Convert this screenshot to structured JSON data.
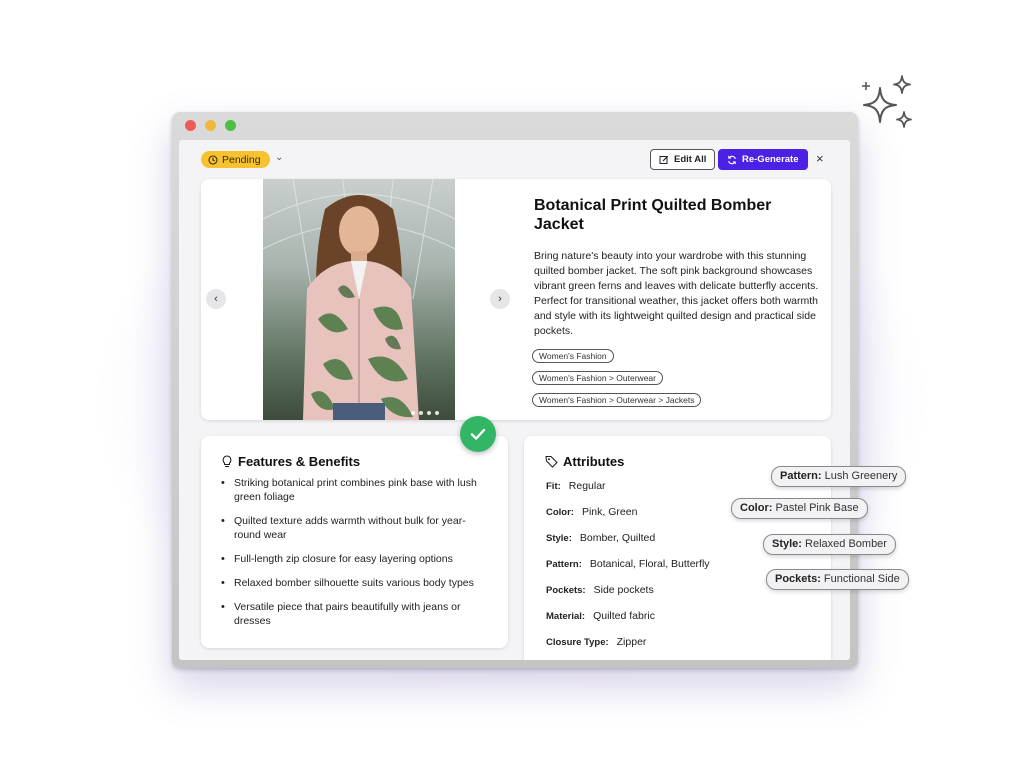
{
  "header": {
    "status": "Pending",
    "edit_all": "Edit All",
    "regenerate": "Re-Generate",
    "close": "×"
  },
  "product": {
    "title": "Botanical Print Quilted Bomber Jacket",
    "description": "Bring nature's beauty into your wardrobe with this stunning quilted bomber jacket. The soft pink background showcases vibrant green ferns and leaves with delicate butterfly accents. Perfect for transitional weather, this jacket offers both warmth and style with its lightweight quilted design and practical side pockets.",
    "categories": [
      "Women's Fashion",
      "Women's Fashion > Outerwear",
      "Women's Fashion > Outerwear > Jackets"
    ]
  },
  "features": {
    "title": "Features & Benefits",
    "items": [
      "Striking botanical print combines pink base with lush green foliage",
      "Quilted texture adds warmth without bulk for year-round wear",
      "Full-length zip closure for easy layering options",
      "Relaxed bomber silhouette suits various body types",
      "Versatile piece that pairs beautifully with jeans or dresses"
    ]
  },
  "attributes": {
    "title": "Attributes",
    "rows": [
      {
        "key": "Fit:",
        "value": "Regular"
      },
      {
        "key": "Color:",
        "value": "Pink, Green"
      },
      {
        "key": "Style:",
        "value": "Bomber, Quilted"
      },
      {
        "key": "Pattern:",
        "value": "Botanical, Floral, Butterfly"
      },
      {
        "key": "Pockets:",
        "value": "Side pockets"
      },
      {
        "key": "Material:",
        "value": "Quilted fabric"
      },
      {
        "key": "Closure Type:",
        "value": "Zipper"
      }
    ]
  },
  "chips": [
    {
      "key": "Pattern:",
      "value": "Lush Greenery"
    },
    {
      "key": "Color:",
      "value": "Pastel Pink Base"
    },
    {
      "key": "Style:",
      "value": "Relaxed Bomber"
    },
    {
      "key": "Pockets:",
      "value": "Functional Side"
    }
  ],
  "icons": {
    "status": "clock-icon",
    "caret": "chevron-down-icon",
    "edit": "edit-icon",
    "regenerate": "refresh-icon",
    "close": "close-icon",
    "features": "lightbulb-icon",
    "attributes": "tag-icon",
    "check": "check-icon",
    "sparkles": "sparkles-icon"
  },
  "colors": {
    "status_pending": "#f6c230",
    "regenerate_button": "#4b21e6",
    "approved_badge": "#33b566"
  }
}
